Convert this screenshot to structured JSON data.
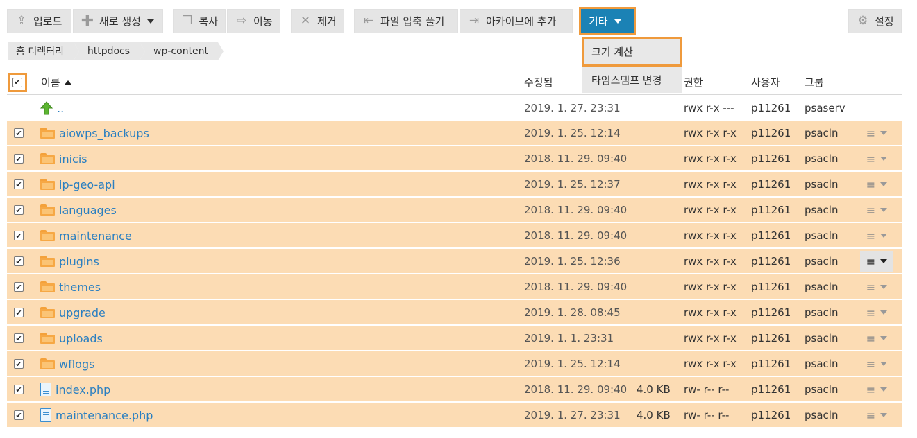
{
  "toolbar": {
    "upload": "업로드",
    "new": "새로 생성",
    "copy": "복사",
    "move": "이동",
    "remove": "제거",
    "extract": "파일 압축 풀기",
    "archive": "아카이브에 추가",
    "more": "기타",
    "settings": "설정"
  },
  "dropdown": {
    "items": [
      "크기 계산",
      "타임스탬프 변경"
    ]
  },
  "breadcrumb": [
    "홈 디렉터리",
    "httpdocs",
    "wp-content"
  ],
  "table": {
    "headers": {
      "name": "이름",
      "modified": "수정됨",
      "perm": "권한",
      "user": "사용자",
      "group": "그룹"
    },
    "parent": {
      "name": "..",
      "modified": "2019. 1. 27. 23:31",
      "perm": "rwx r-x ---",
      "user": "p11261",
      "group": "psaserv"
    },
    "rows": [
      {
        "name": "aiowps_backups",
        "type": "folder",
        "modified": "2019. 1. 25. 12:14",
        "size": "",
        "perm": "rwx r-x r-x",
        "user": "p11261",
        "group": "psacln"
      },
      {
        "name": "inicis",
        "type": "folder",
        "modified": "2018. 11. 29. 09:40",
        "size": "",
        "perm": "rwx r-x r-x",
        "user": "p11261",
        "group": "psacln"
      },
      {
        "name": "ip-geo-api",
        "type": "folder",
        "modified": "2019. 1. 25. 12:37",
        "size": "",
        "perm": "rwx r-x r-x",
        "user": "p11261",
        "group": "psacln"
      },
      {
        "name": "languages",
        "type": "folder",
        "modified": "2018. 11. 29. 09:40",
        "size": "",
        "perm": "rwx r-x r-x",
        "user": "p11261",
        "group": "psacln"
      },
      {
        "name": "maintenance",
        "type": "folder",
        "modified": "2018. 11. 29. 09:40",
        "size": "",
        "perm": "rwx r-x r-x",
        "user": "p11261",
        "group": "psacln"
      },
      {
        "name": "plugins",
        "type": "folder",
        "modified": "2019. 1. 25. 12:36",
        "size": "",
        "perm": "rwx r-x r-x",
        "user": "p11261",
        "group": "psacln"
      },
      {
        "name": "themes",
        "type": "folder",
        "modified": "2018. 11. 29. 09:40",
        "size": "",
        "perm": "rwx r-x r-x",
        "user": "p11261",
        "group": "psacln"
      },
      {
        "name": "upgrade",
        "type": "folder",
        "modified": "2019. 1. 28. 08:45",
        "size": "",
        "perm": "rwx r-x r-x",
        "user": "p11261",
        "group": "psacln"
      },
      {
        "name": "uploads",
        "type": "folder",
        "modified": "2019. 1. 1. 23:31",
        "size": "",
        "perm": "rwx r-x r-x",
        "user": "p11261",
        "group": "psacln"
      },
      {
        "name": "wflogs",
        "type": "folder",
        "modified": "2019. 1. 25. 12:14",
        "size": "",
        "perm": "rwx r-x r-x",
        "user": "p11261",
        "group": "psacln"
      },
      {
        "name": "index.php",
        "type": "file",
        "modified": "2018. 11. 29. 09:40",
        "size": "4.0 KB",
        "perm": "rw- r-- r--",
        "user": "p11261",
        "group": "psacln"
      },
      {
        "name": "maintenance.php",
        "type": "file",
        "modified": "2019. 1. 27. 23:31",
        "size": "4.0 KB",
        "perm": "rw- r-- r--",
        "user": "p11261",
        "group": "psacln"
      }
    ]
  },
  "icons": {
    "check": "✔",
    "actions": "≡"
  }
}
